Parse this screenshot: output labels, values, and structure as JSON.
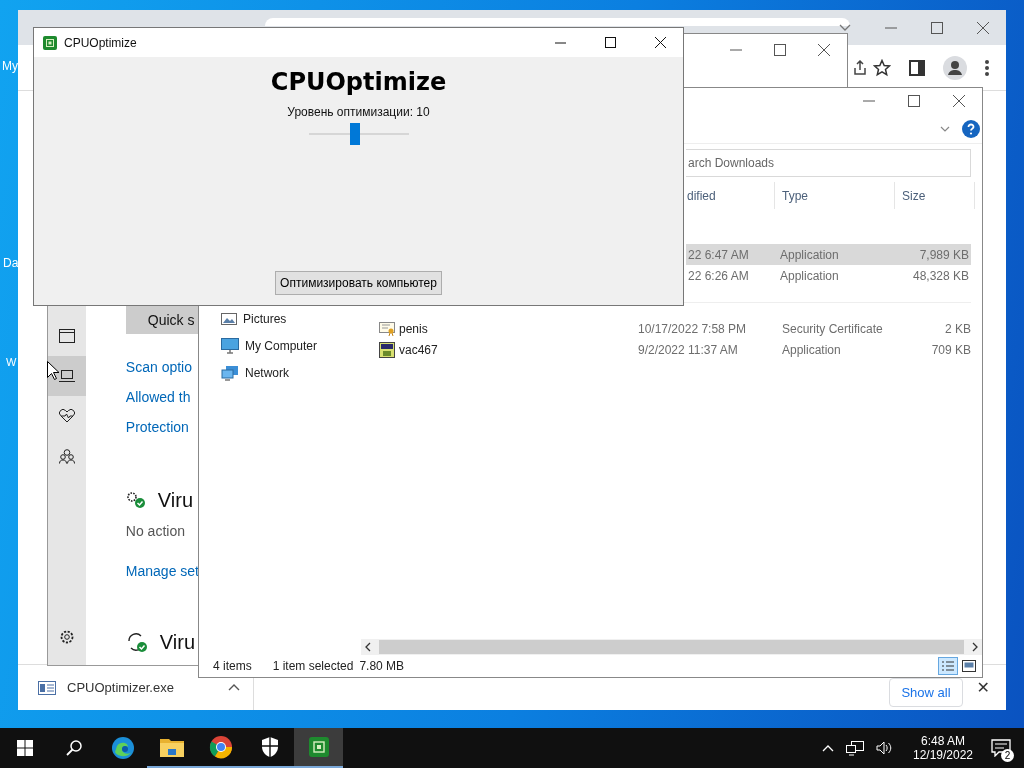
{
  "desktop": {
    "icon_labels": [
      "My",
      "Da",
      "W"
    ]
  },
  "browser": {
    "download_shelf": {
      "file": "CPUOptimizer.exe",
      "show_all": "Show all",
      "close": "✕"
    }
  },
  "security_window": {
    "sidebar": [
      {
        "kind": "window",
        "selected": false
      },
      {
        "kind": "laptop",
        "selected": true
      },
      {
        "kind": "heart",
        "selected": false
      },
      {
        "kind": "family",
        "selected": false
      },
      {
        "kind": "gear",
        "selected": false
      }
    ],
    "quick_button": "Quick s",
    "links": [
      "Scan optio",
      "Allowed th",
      "Protection"
    ],
    "sections": [
      {
        "kind": "gears",
        "heading": "Viru",
        "text": "No action",
        "link": "Manage set"
      },
      {
        "kind": "sync",
        "heading": "Viru"
      }
    ]
  },
  "explorer": {
    "search": {
      "placeholder": "arch Downloads"
    },
    "columns": [
      "dified",
      "Type",
      "Size"
    ],
    "nav": [
      {
        "kind": "pictures",
        "label": "Pictures"
      },
      {
        "kind": "computer",
        "label": "My Computer"
      },
      {
        "kind": "network",
        "label": "Network"
      }
    ],
    "rows": [
      {
        "date": "22 6:47 AM",
        "type": "Application",
        "size": "7,989 KB",
        "selected": true
      },
      {
        "date": "22 6:26 AM",
        "type": "Application",
        "size": "48,328 KB",
        "selected": false
      },
      {
        "kind": "certificate",
        "name": "penis",
        "date": "10/17/2022 7:58 PM",
        "type": "Security Certificate",
        "size": "2 KB",
        "selected": false
      },
      {
        "kind": "application",
        "name": "vac467",
        "date": "9/2/2022 11:37 AM",
        "type": "Application",
        "size": "709 KB",
        "selected": false
      }
    ],
    "status": {
      "count": "4 items",
      "selection": "1 item selected",
      "selection_size": "7.80 MB"
    }
  },
  "app": {
    "title": "CPUOptimize",
    "heading": "CPUOptimize",
    "level_label": "Уровень оптимизации: 10",
    "slider": {
      "level": 0.46
    },
    "button": "Оптимизировать компьютер"
  },
  "taskbar": {
    "buttons": [
      {
        "kind": "start",
        "running": false,
        "selected": false
      },
      {
        "kind": "search",
        "running": false,
        "selected": false
      },
      {
        "kind": "edge",
        "running": false,
        "selected": false
      },
      {
        "kind": "folder",
        "running": true,
        "selected": false
      },
      {
        "kind": "chrome",
        "running": true,
        "selected": false
      },
      {
        "kind": "shield",
        "running": true,
        "selected": false
      },
      {
        "kind": "cpu",
        "running": true,
        "selected": true
      }
    ],
    "time": "6:48 AM",
    "date": "12/19/2022",
    "notifications": "2"
  }
}
